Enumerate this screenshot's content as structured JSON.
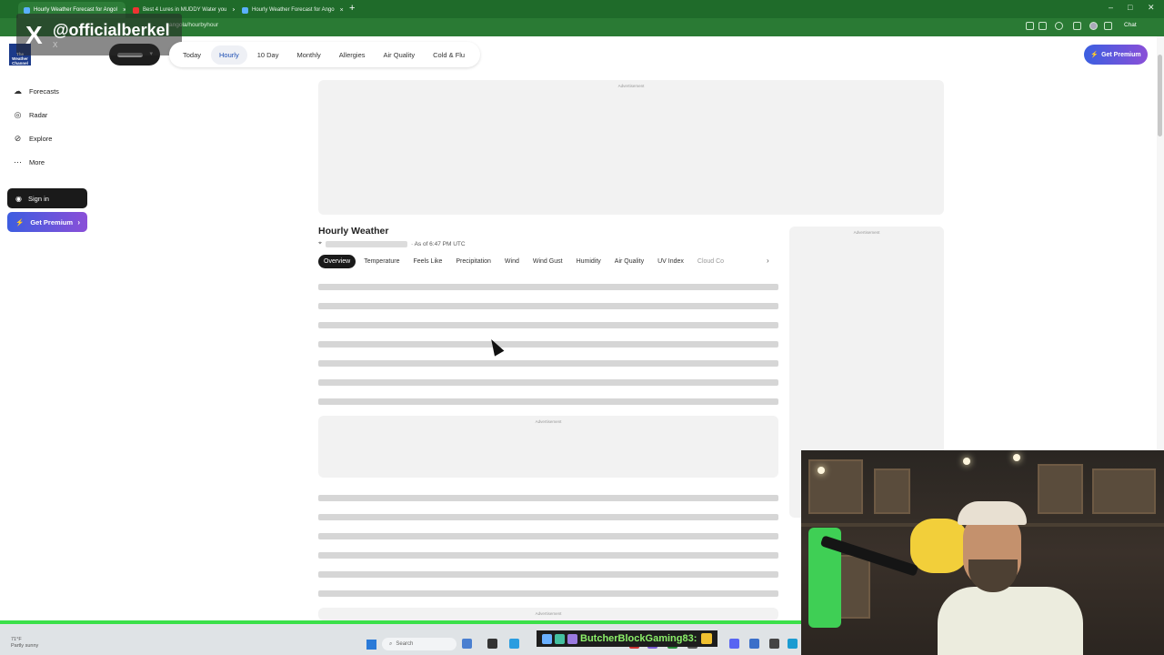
{
  "browser": {
    "tabs": [
      {
        "title": "Hourly Weather Forecast for Angol",
        "active": true,
        "close": "×"
      },
      {
        "title": "Best 4 Lures in MUDDY Water you",
        "active": false,
        "close": "×"
      },
      {
        "title": "Hourly Weather Forecast for Ango",
        "active": false,
        "close": "×"
      }
    ],
    "new_tab": "+",
    "url": "angola/hourbyhour",
    "chat_label": "Chat",
    "window_controls": [
      "–",
      "□",
      "✕"
    ]
  },
  "overlay": {
    "x_mark": "X",
    "handle": "@officialberkel",
    "sub": "X"
  },
  "site": {
    "logo_text": "The Weather Channel",
    "nav": [
      "Today",
      "Hourly",
      "10 Day",
      "Monthly",
      "Allergies",
      "Air Quality",
      "Cold & Flu"
    ],
    "nav_active": "Hourly",
    "premium_top": "Get Premium"
  },
  "sidebar": {
    "items": [
      {
        "label": "Forecasts",
        "icon": "cloud-icon"
      },
      {
        "label": "Radar",
        "icon": "radar-icon"
      },
      {
        "label": "Explore",
        "icon": "compass-icon"
      },
      {
        "label": "More",
        "icon": "more-dots-icon"
      }
    ],
    "sign_in": "Sign in",
    "get_premium": "Get Premium"
  },
  "ads": {
    "label": "Advertisement"
  },
  "hourly": {
    "title": "Hourly Weather",
    "as_of": "· As of 6:47 PM UTC",
    "tabs": [
      "Overview",
      "Temperature",
      "Feels Like",
      "Precipitation",
      "Wind",
      "Wind Gust",
      "Humidity",
      "Air Quality",
      "UV Index",
      "Cloud Co"
    ],
    "active_tab": "Overview"
  },
  "taskbar": {
    "weather_temp": "71°F",
    "weather_desc": "Partly sunny",
    "search_placeholder": "Search"
  },
  "stream_chat": {
    "username": "ButcherBlockGaming83:"
  },
  "colors": {
    "browser_green": "#1f6b2a",
    "premium_gradient_start": "#3b5fe0",
    "premium_gradient_end": "#8a4fd8",
    "chat_name": "#8cf06a"
  }
}
